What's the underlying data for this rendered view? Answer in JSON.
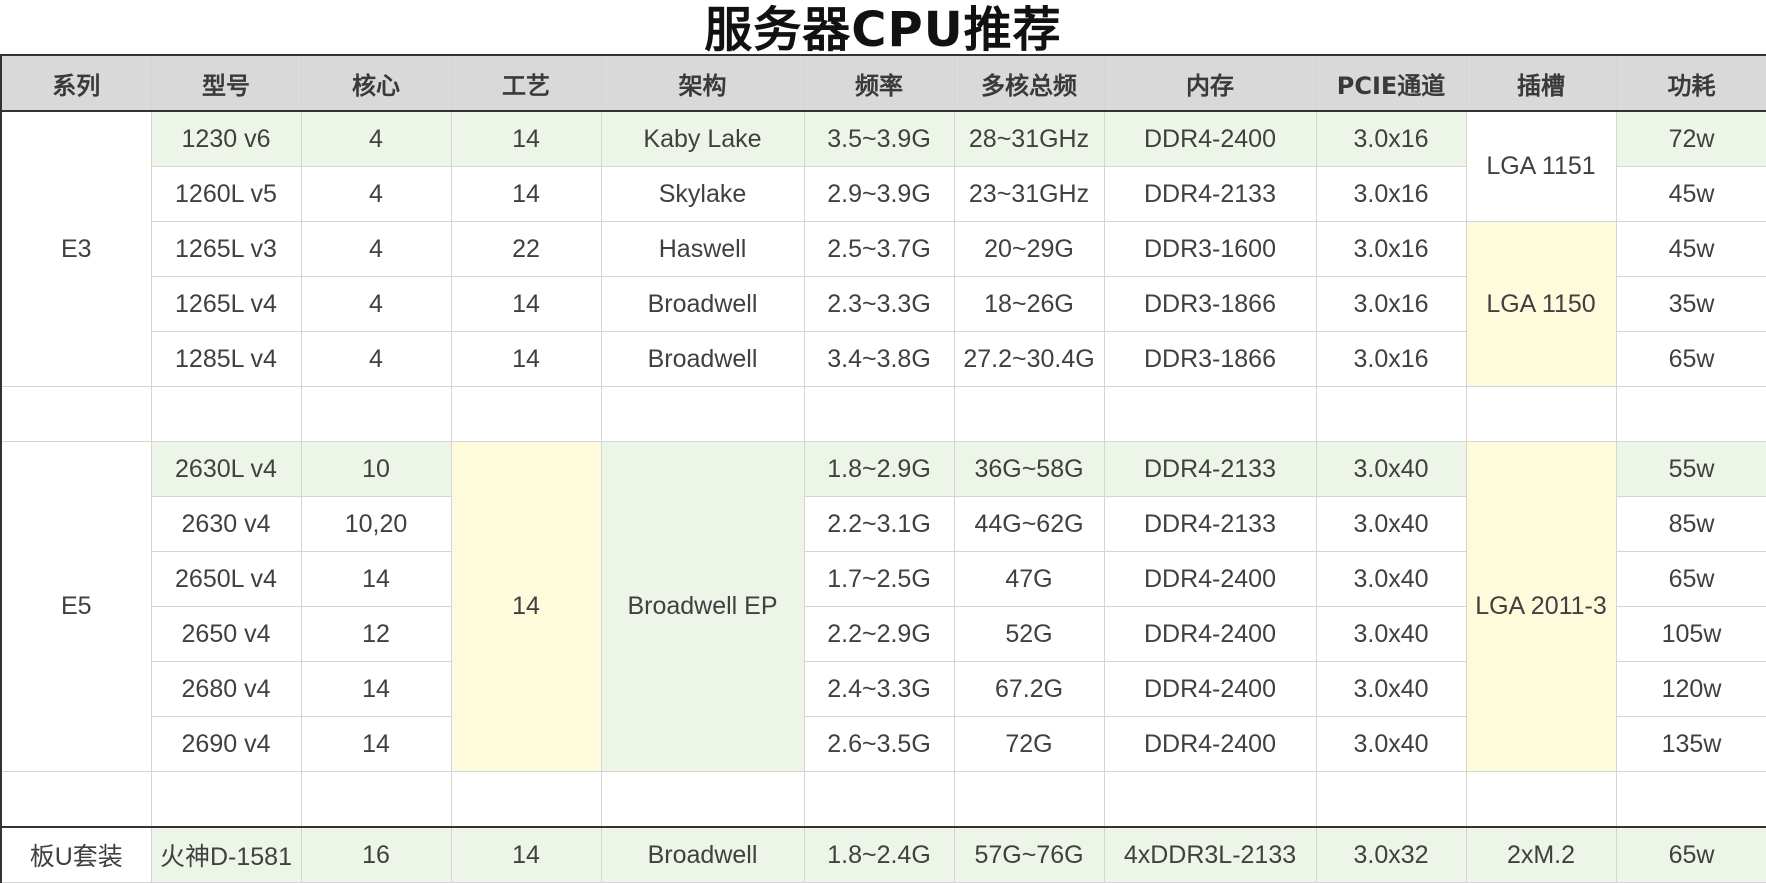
{
  "title": "服务器CPU推荐",
  "headers": [
    "系列",
    "型号",
    "核心",
    "工艺",
    "架构",
    "频率",
    "多核总频",
    "内存",
    "PCIE通道",
    "插槽",
    "功耗"
  ],
  "e3": {
    "series": "E3",
    "rows": [
      {
        "model": "1230 v6",
        "cores": "4",
        "process": "14",
        "arch": "Kaby Lake",
        "freq": "3.5~3.9G",
        "total": "28~31GHz",
        "mem": "DDR4-2400",
        "pcie": "3.0x16",
        "power": "72w"
      },
      {
        "model": "1260L v5",
        "cores": "4",
        "process": "14",
        "arch": "Skylake",
        "freq": "2.9~3.9G",
        "total": "23~31GHz",
        "mem": "DDR4-2133",
        "pcie": "3.0x16",
        "power": "45w"
      },
      {
        "model": "1265L v3",
        "cores": "4",
        "process": "22",
        "arch": "Haswell",
        "freq": "2.5~3.7G",
        "total": "20~29G",
        "mem": "DDR3-1600",
        "pcie": "3.0x16",
        "power": "45w"
      },
      {
        "model": "1265L v4",
        "cores": "4",
        "process": "14",
        "arch": "Broadwell",
        "freq": "2.3~3.3G",
        "total": "18~26G",
        "mem": "DDR3-1866",
        "pcie": "3.0x16",
        "power": "35w"
      },
      {
        "model": "1285L v4",
        "cores": "4",
        "process": "14",
        "arch": "Broadwell",
        "freq": "3.4~3.8G",
        "total": "27.2~30.4G",
        "mem": "DDR3-1866",
        "pcie": "3.0x16",
        "power": "65w"
      }
    ],
    "socket_1151": "LGA 1151",
    "socket_1150": "LGA 1150"
  },
  "e5": {
    "series": "E5",
    "process": "14",
    "arch": "Broadwell EP",
    "socket": "LGA 2011-3",
    "rows": [
      {
        "model": "2630L v4",
        "cores": "10",
        "freq": "1.8~2.9G",
        "total": "36G~58G",
        "mem": "DDR4-2133",
        "pcie": "3.0x40",
        "power": "55w"
      },
      {
        "model": "2630 v4",
        "cores": "10,20",
        "freq": "2.2~3.1G",
        "total": "44G~62G",
        "mem": "DDR4-2133",
        "pcie": "3.0x40",
        "power": "85w"
      },
      {
        "model": "2650L v4",
        "cores": "14",
        "freq": "1.7~2.5G",
        "total": "47G",
        "mem": "DDR4-2400",
        "pcie": "3.0x40",
        "power": "65w"
      },
      {
        "model": "2650 v4",
        "cores": "12",
        "freq": "2.2~2.9G",
        "total": "52G",
        "mem": "DDR4-2400",
        "pcie": "3.0x40",
        "power": "105w"
      },
      {
        "model": "2680 v4",
        "cores": "14",
        "freq": "2.4~3.3G",
        "total": "67.2G",
        "mem": "DDR4-2400",
        "pcie": "3.0x40",
        "power": "120w"
      },
      {
        "model": "2690 v4",
        "cores": "14",
        "freq": "2.6~3.5G",
        "total": "72G",
        "mem": "DDR4-2400",
        "pcie": "3.0x40",
        "power": "135w"
      }
    ]
  },
  "board": {
    "series": "板U套装",
    "model": "火神D-1581",
    "cores": "16",
    "process": "14",
    "arch": "Broadwell",
    "freq": "1.8~2.4G",
    "total": "57G~76G",
    "mem": "4xDDR3L-2133",
    "pcie": "3.0x32",
    "socket": "2xM.2",
    "power": "65w"
  },
  "colors": {
    "green": "#edf5e8",
    "yellow": "#fdfbdc",
    "header": "#d9d9d9"
  }
}
